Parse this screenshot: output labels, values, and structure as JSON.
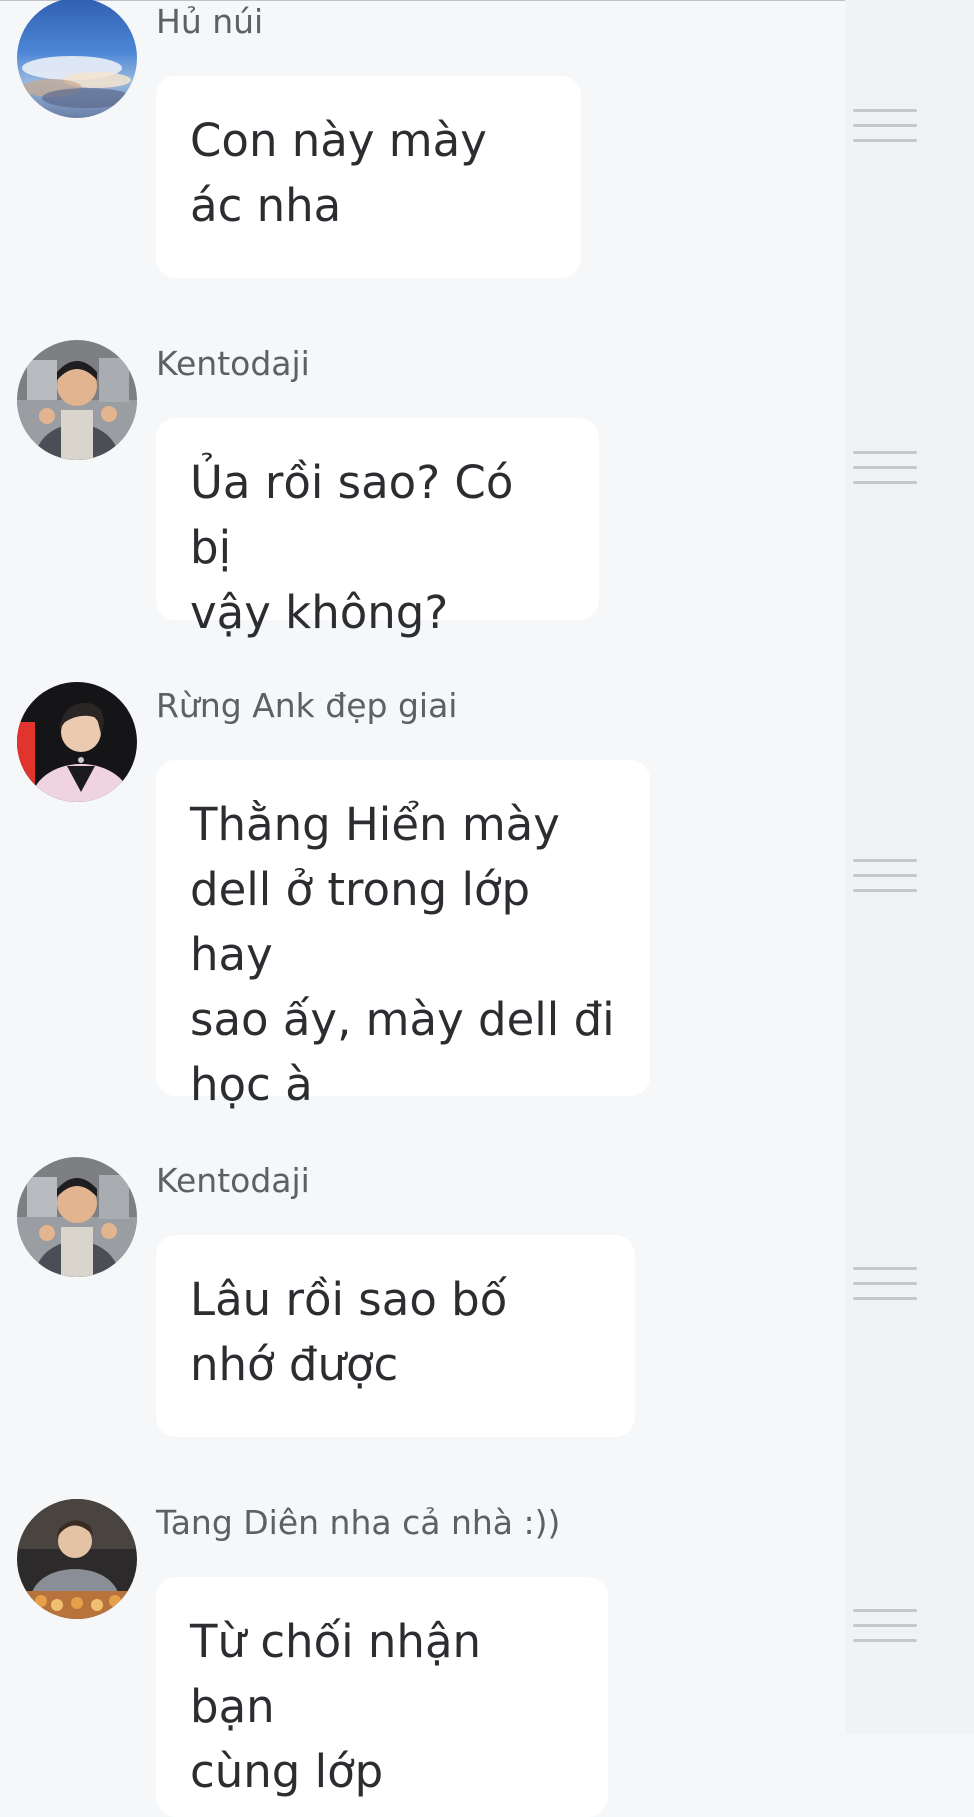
{
  "messages": [
    {
      "sender": "Hủ núi",
      "text": "Con này mày\nác nha",
      "avatar_icon": "sky-avatar-icon"
    },
    {
      "sender": "Kentodaji",
      "text": "Ủa rồi sao? Có bị\nvậy không?",
      "avatar_icon": "kentodaji-avatar-icon"
    },
    {
      "sender": "Rừng Ank đẹp giai",
      "text": "Thằng Hiển mày\ndell ở trong lớp hay\nsao ấy, mày dell đi\nhọc à",
      "avatar_icon": "rung-ank-avatar-icon"
    },
    {
      "sender": "Kentodaji",
      "text": "Lâu rồi sao bố\nnhớ được",
      "avatar_icon": "kentodaji-avatar-icon"
    },
    {
      "sender": "Tang Diên nha cả nhà :))",
      "text": "Từ chối nhận bạn\ncùng lớp",
      "avatar_icon": "tang-dien-avatar-icon"
    }
  ],
  "colors": {
    "background": "#f6f7f9",
    "side_strip": "#f1f2f4",
    "bubble": "#ffffff",
    "text": "#2b2d30",
    "sender": "#5d6064",
    "menu_lines": "#c6c8cb"
  }
}
